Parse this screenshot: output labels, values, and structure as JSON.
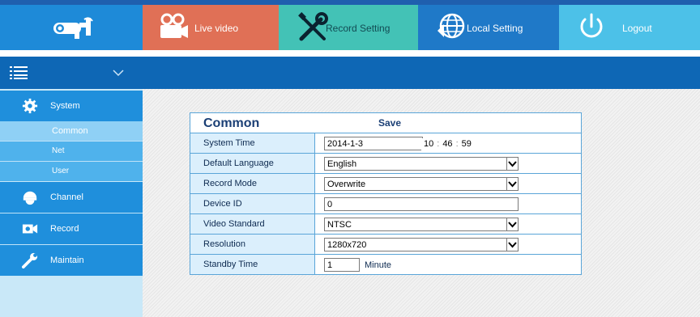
{
  "header": {
    "nav": [
      {
        "key": "live",
        "label": "Live video",
        "icon": "camera-icon"
      },
      {
        "key": "record",
        "label": "Record Setting",
        "icon": "tools-icon"
      },
      {
        "key": "local",
        "label": "Local Setting",
        "icon": "globe-icon"
      },
      {
        "key": "logout",
        "label": "Logout",
        "icon": "power-icon"
      }
    ],
    "logo_icon": "cctv-camera-logo"
  },
  "sidebar": {
    "menu_icon": "list-icon",
    "collapse_icon": "chevron-down-icon",
    "items": [
      {
        "label": "System",
        "icon": "gear-icon"
      },
      {
        "label": "Channel",
        "icon": "dome-camera-icon"
      },
      {
        "label": "Record",
        "icon": "record-camera-icon"
      },
      {
        "label": "Maintain",
        "icon": "wrench-icon"
      }
    ],
    "sub_items": [
      {
        "label": "Common",
        "active": true
      },
      {
        "label": "Net",
        "active": false
      },
      {
        "label": "User",
        "active": false
      }
    ]
  },
  "panel": {
    "title": "Common",
    "save_label": "Save",
    "rows": [
      {
        "label": "System Time",
        "value": "2014-1-3"
      },
      {
        "label": "Default Language",
        "value": "English"
      },
      {
        "label": "Record Mode",
        "value": "Overwrite"
      },
      {
        "label": "Device ID",
        "value": "0"
      },
      {
        "label": "Video Standard",
        "value": "NTSC"
      },
      {
        "label": "Resolution",
        "value": "1280x720"
      },
      {
        "label": "Standby Time",
        "value": "1"
      }
    ],
    "time": {
      "hour": "10",
      "minute": "46",
      "second": "59"
    },
    "standby_unit": "Minute"
  },
  "colors": {
    "header_blue": "#1f8fdc",
    "live_tab": "#e07056",
    "record_tab": "#43c2b6",
    "local_tab": "#1f79c8",
    "logout_tab": "#4cc1e8",
    "dark_band": "#0e67b5",
    "panel_border": "#5aa5d8"
  }
}
